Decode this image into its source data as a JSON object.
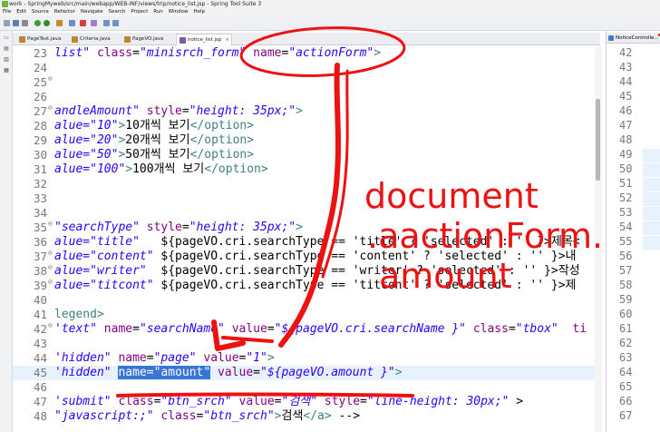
{
  "window": {
    "title": "work - SpringMyweb/src/main/webapp/WEB-INF/views/trip/notice_list.jsp - Spring Tool Suite 3"
  },
  "menu": [
    "File",
    "Edit",
    "Source",
    "Refactor",
    "Navigate",
    "Search",
    "Project",
    "Run",
    "Window",
    "Help"
  ],
  "tabs": [
    {
      "label": "PageTest.java",
      "color": "#c0852f",
      "active": false
    },
    {
      "label": "Criteria.java",
      "color": "#c0852f",
      "active": false
    },
    {
      "label": "PageVO.java",
      "color": "#c0852f",
      "active": false
    },
    {
      "label": "notice_list.jsp",
      "color": "#7a5aa0",
      "active": true
    }
  ],
  "side_panel": {
    "tab_label": "NoticeControlle...",
    "line_numbers": [
      "42",
      "43",
      "44",
      "45",
      "46",
      "47",
      "48",
      "49",
      "50",
      "51",
      "52",
      "53",
      "54",
      "55",
      "56",
      "57",
      "58",
      "59",
      "60",
      "61",
      "62",
      "63",
      "64",
      "65",
      "66",
      "67"
    ]
  },
  "annotation": {
    "lines": [
      "document",
      ".aactionForm.",
      "amount"
    ],
    "color": "#ee1111"
  },
  "code_lines": [
    {
      "n": "23",
      "fold": "",
      "hl": false,
      "tokens": [
        {
          "c": "s",
          "t": "list\""
        },
        {
          "c": "k",
          "t": " "
        },
        {
          "c": "a",
          "t": "class"
        },
        {
          "c": "k",
          "t": "="
        },
        {
          "c": "s",
          "t": "\"minisrch_form\""
        },
        {
          "c": "k",
          "t": " "
        },
        {
          "c": "a",
          "t": "name"
        },
        {
          "c": "k",
          "t": "="
        },
        {
          "c": "s",
          "t": "\"actionForm\""
        },
        {
          "c": "t",
          "t": ">"
        }
      ]
    },
    {
      "n": "24",
      "fold": "",
      "hl": false,
      "tokens": []
    },
    {
      "n": "25",
      "fold": "⊖",
      "hl": false,
      "tokens": []
    },
    {
      "n": "26",
      "fold": "",
      "hl": false,
      "tokens": []
    },
    {
      "n": "27",
      "fold": "⊖",
      "hl": false,
      "tokens": [
        {
          "c": "s",
          "t": "andleAmount\""
        },
        {
          "c": "k",
          "t": " "
        },
        {
          "c": "a",
          "t": "style"
        },
        {
          "c": "k",
          "t": "="
        },
        {
          "c": "s",
          "t": "\"height: 35px;\""
        },
        {
          "c": "t",
          "t": ">"
        }
      ]
    },
    {
      "n": "28",
      "fold": "",
      "hl": false,
      "tokens": [
        {
          "c": "s",
          "t": "alue=\"10\""
        },
        {
          "c": "t",
          "t": ">"
        },
        {
          "c": "k",
          "t": "10개씩 보기"
        },
        {
          "c": "t",
          "t": "</option>"
        }
      ]
    },
    {
      "n": "29",
      "fold": "",
      "hl": false,
      "tokens": [
        {
          "c": "s",
          "t": "alue=\"20\""
        },
        {
          "c": "t",
          "t": ">"
        },
        {
          "c": "k",
          "t": "20개씩 보기"
        },
        {
          "c": "t",
          "t": "</option>"
        }
      ]
    },
    {
      "n": "30",
      "fold": "",
      "hl": false,
      "tokens": [
        {
          "c": "s",
          "t": "alue=\"50\""
        },
        {
          "c": "t",
          "t": ">"
        },
        {
          "c": "k",
          "t": "50개씩 보기"
        },
        {
          "c": "t",
          "t": "</option>"
        }
      ]
    },
    {
      "n": "31",
      "fold": "",
      "hl": false,
      "tokens": [
        {
          "c": "s",
          "t": "alue=\"100\""
        },
        {
          "c": "t",
          "t": ">"
        },
        {
          "c": "k",
          "t": "100개씩 보기"
        },
        {
          "c": "t",
          "t": "</option>"
        }
      ]
    },
    {
      "n": "32",
      "fold": "",
      "hl": false,
      "tokens": []
    },
    {
      "n": "33",
      "fold": "",
      "hl": false,
      "tokens": []
    },
    {
      "n": "34",
      "fold": "",
      "hl": false,
      "tokens": []
    },
    {
      "n": "35",
      "fold": "⊖",
      "hl": false,
      "tokens": [
        {
          "c": "s",
          "t": "\"searchType\""
        },
        {
          "c": "k",
          "t": " "
        },
        {
          "c": "a",
          "t": "style"
        },
        {
          "c": "k",
          "t": "="
        },
        {
          "c": "s",
          "t": "\"height: 35px;\""
        },
        {
          "c": "t",
          "t": ">"
        }
      ]
    },
    {
      "n": "36",
      "fold": "",
      "hl": false,
      "tokens": [
        {
          "c": "s",
          "t": "alue=\"title\""
        },
        {
          "c": "k",
          "t": "   ${pageVO.cri.searchType == 'title' ? 'selected' : '' }>제목<"
        }
      ]
    },
    {
      "n": "37",
      "fold": "⊖",
      "hl": false,
      "tokens": [
        {
          "c": "s",
          "t": "alue=\"content\""
        },
        {
          "c": "k",
          "t": " ${pageVO.cri.searchType == 'content' ? 'selected' : '' }>내"
        }
      ]
    },
    {
      "n": "38",
      "fold": "⊖",
      "hl": false,
      "tokens": [
        {
          "c": "s",
          "t": "alue=\"writer\""
        },
        {
          "c": "k",
          "t": "  ${pageVO.cri.searchType == 'writer' ? 'selected' : '' }>작성"
        }
      ]
    },
    {
      "n": "39",
      "fold": "⊖",
      "hl": false,
      "tokens": [
        {
          "c": "s",
          "t": "alue=\"titcont\""
        },
        {
          "c": "k",
          "t": " ${pageVO.cri.searchType == 'titcont' ? 'selected' : '' }>제"
        }
      ]
    },
    {
      "n": "40",
      "fold": "",
      "hl": false,
      "tokens": []
    },
    {
      "n": "41",
      "fold": "",
      "hl": false,
      "tokens": [
        {
          "c": "t",
          "t": "legend>"
        }
      ]
    },
    {
      "n": "42",
      "fold": "⊖",
      "hl": false,
      "tokens": [
        {
          "c": "s",
          "t": "'text\""
        },
        {
          "c": "k",
          "t": " "
        },
        {
          "c": "a",
          "t": "name"
        },
        {
          "c": "k",
          "t": "="
        },
        {
          "c": "s",
          "t": "\"searchName\""
        },
        {
          "c": "k",
          "t": " "
        },
        {
          "c": "a",
          "t": "value"
        },
        {
          "c": "k",
          "t": "="
        },
        {
          "c": "s",
          "t": "\"${pageVO.cri.searchName }\""
        },
        {
          "c": "k",
          "t": " "
        },
        {
          "c": "a",
          "t": "class"
        },
        {
          "c": "k",
          "t": "="
        },
        {
          "c": "s",
          "t": "\"tbox\""
        },
        {
          "c": "k",
          "t": "  "
        },
        {
          "c": "a",
          "t": "ti"
        }
      ]
    },
    {
      "n": "43",
      "fold": "",
      "hl": false,
      "tokens": []
    },
    {
      "n": "44",
      "fold": "",
      "hl": false,
      "tokens": [
        {
          "c": "s",
          "t": "'hidden\""
        },
        {
          "c": "k",
          "t": " "
        },
        {
          "c": "a",
          "t": "name"
        },
        {
          "c": "k",
          "t": "="
        },
        {
          "c": "s",
          "t": "\"page\""
        },
        {
          "c": "k",
          "t": " "
        },
        {
          "c": "a",
          "t": "value"
        },
        {
          "c": "k",
          "t": "="
        },
        {
          "c": "s",
          "t": "\"1\""
        },
        {
          "c": "t",
          "t": ">"
        }
      ]
    },
    {
      "n": "45",
      "fold": "",
      "hl": true,
      "tokens": [
        {
          "c": "s",
          "t": "'hidden\""
        },
        {
          "c": "k",
          "t": " "
        },
        {
          "c": "sel",
          "t": "name=\"amount\""
        },
        {
          "c": "k",
          "t": " "
        },
        {
          "c": "a",
          "t": "value"
        },
        {
          "c": "k",
          "t": "="
        },
        {
          "c": "s",
          "t": "\"${pageVO.amount }\""
        },
        {
          "c": "t",
          "t": ">"
        }
      ]
    },
    {
      "n": "46",
      "fold": "",
      "hl": false,
      "tokens": []
    },
    {
      "n": "47",
      "fold": "",
      "hl": false,
      "tokens": [
        {
          "c": "s",
          "t": "'submit\""
        },
        {
          "c": "k",
          "t": " "
        },
        {
          "c": "a",
          "t": "class"
        },
        {
          "c": "k",
          "t": "="
        },
        {
          "c": "s",
          "t": "\"btn_srch\""
        },
        {
          "c": "k",
          "t": " "
        },
        {
          "c": "a",
          "t": "value"
        },
        {
          "c": "k",
          "t": "="
        },
        {
          "c": "s",
          "t": "\"검색\""
        },
        {
          "c": "k",
          "t": " "
        },
        {
          "c": "a",
          "t": "style"
        },
        {
          "c": "k",
          "t": "="
        },
        {
          "c": "s",
          "t": "\"line-height: 30px;\""
        },
        {
          "c": "k",
          "t": " >"
        }
      ]
    },
    {
      "n": "48",
      "fold": "",
      "hl": false,
      "tokens": [
        {
          "c": "s",
          "t": "\"javascript:;\""
        },
        {
          "c": "k",
          "t": " "
        },
        {
          "c": "a",
          "t": "class"
        },
        {
          "c": "k",
          "t": "="
        },
        {
          "c": "s",
          "t": "\"btn_srch\""
        },
        {
          "c": "t",
          "t": ">"
        },
        {
          "c": "k",
          "t": "검색"
        },
        {
          "c": "t",
          "t": "</a>"
        },
        {
          "c": "k",
          "t": " -->"
        }
      ]
    }
  ]
}
